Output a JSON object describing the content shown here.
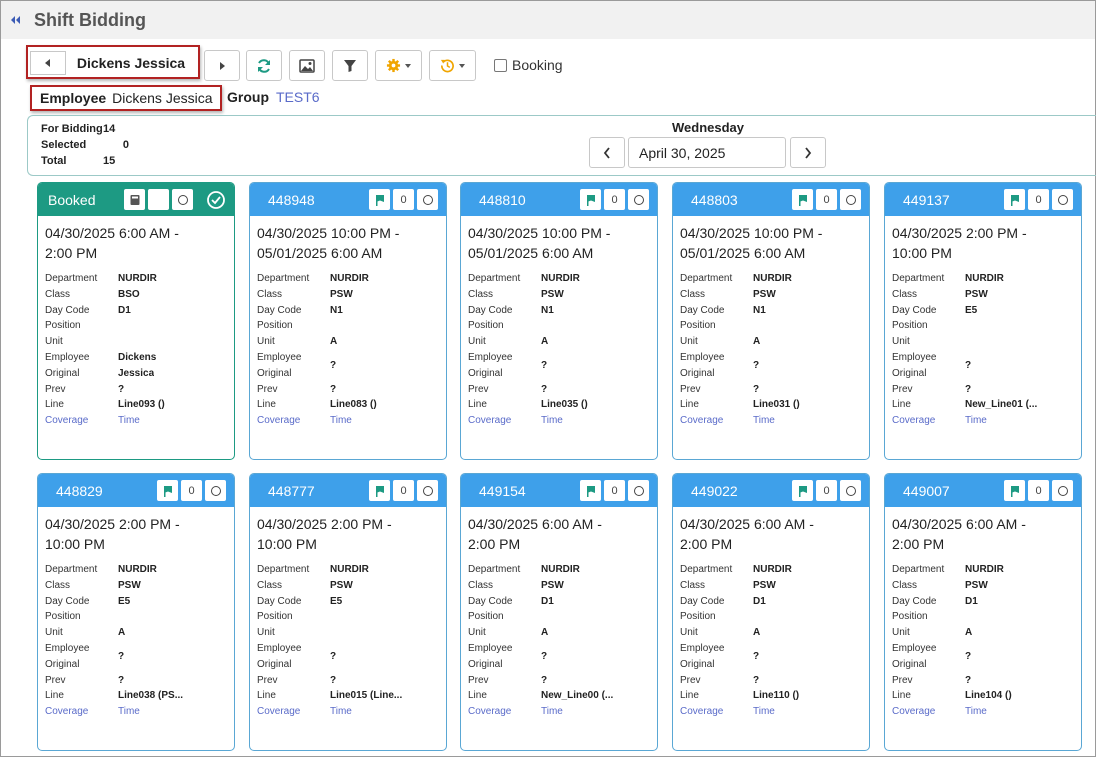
{
  "app": {
    "title": "Shift Bidding"
  },
  "toolbar": {
    "employee_nav_name": "Dickens Jessica",
    "booking_label": "Booking"
  },
  "employee": {
    "label": "Employee",
    "value": "Dickens Jessica"
  },
  "group": {
    "label": "Group",
    "value": "TEST6"
  },
  "summary": {
    "for_bidding_label": "For Bidding",
    "for_bidding": "14",
    "selected_label": "Selected",
    "selected": "0",
    "total_label": "Total",
    "total": "15"
  },
  "date": {
    "day": "Wednesday",
    "value": "April 30, 2025"
  },
  "field_labels": {
    "department": "Department",
    "class": "Class",
    "day_code": "Day Code",
    "position": "Position",
    "unit": "Unit",
    "employee": "Employee",
    "original": "Original",
    "prev": "Prev",
    "line": "Line",
    "coverage": "Coverage",
    "time": "Time"
  },
  "colors": {
    "card_header": "#3ea0ea",
    "booked_header": "#1d9a83",
    "link": "#5a6bc9",
    "highlight_border": "#b22222"
  },
  "cards": [
    {
      "id": "Booked",
      "booked": true,
      "count": "",
      "time1": "04/30/2025 6:00 AM -",
      "time2": "2:00 PM",
      "department": "NURDIR",
      "class": "BSO",
      "day_code": "D1",
      "position": "",
      "unit": "",
      "employee": "Dickens",
      "original": "Jessica",
      "prev": "?",
      "line": "Line093 ()"
    },
    {
      "id": "448948",
      "count": "0",
      "time1": "04/30/2025 10:00 PM -",
      "time2": "05/01/2025 6:00 AM",
      "department": "NURDIR",
      "class": "PSW",
      "day_code": "N1",
      "position": "",
      "unit": "A",
      "employee": "?",
      "original": "",
      "prev": "?",
      "line": "Line083 ()"
    },
    {
      "id": "448810",
      "count": "0",
      "time1": "04/30/2025 10:00 PM -",
      "time2": "05/01/2025 6:00 AM",
      "department": "NURDIR",
      "class": "PSW",
      "day_code": "N1",
      "position": "",
      "unit": "A",
      "employee": "?",
      "original": "",
      "prev": "?",
      "line": "Line035 ()"
    },
    {
      "id": "448803",
      "count": "0",
      "time1": "04/30/2025 10:00 PM -",
      "time2": "05/01/2025 6:00 AM",
      "department": "NURDIR",
      "class": "PSW",
      "day_code": "N1",
      "position": "",
      "unit": "A",
      "employee": "?",
      "original": "",
      "prev": "?",
      "line": "Line031 ()"
    },
    {
      "id": "449137",
      "count": "0",
      "time1": "04/30/2025 2:00 PM -",
      "time2": "10:00 PM",
      "department": "NURDIR",
      "class": "PSW",
      "day_code": "E5",
      "position": "",
      "unit": "",
      "employee": "?",
      "original": "",
      "prev": "?",
      "line": "New_Line01 (..."
    },
    {
      "id": "448829",
      "count": "0",
      "time1": "04/30/2025 2:00 PM -",
      "time2": "10:00 PM",
      "department": "NURDIR",
      "class": "PSW",
      "day_code": "E5",
      "position": "",
      "unit": "A",
      "employee": "?",
      "original": "",
      "prev": "?",
      "line": "Line038 (PS..."
    },
    {
      "id": "448777",
      "count": "0",
      "time1": "04/30/2025 2:00 PM -",
      "time2": "10:00 PM",
      "department": "NURDIR",
      "class": "PSW",
      "day_code": "E5",
      "position": "",
      "unit": "",
      "employee": "?",
      "original": "",
      "prev": "?",
      "line": "Line015 (Line..."
    },
    {
      "id": "449154",
      "count": "0",
      "time1": "04/30/2025 6:00 AM -",
      "time2": "2:00 PM",
      "department": "NURDIR",
      "class": "PSW",
      "day_code": "D1",
      "position": "",
      "unit": "A",
      "employee": "?",
      "original": "",
      "prev": "?",
      "line": "New_Line00 (..."
    },
    {
      "id": "449022",
      "count": "0",
      "time1": "04/30/2025 6:00 AM -",
      "time2": "2:00 PM",
      "department": "NURDIR",
      "class": "PSW",
      "day_code": "D1",
      "position": "",
      "unit": "A",
      "employee": "?",
      "original": "",
      "prev": "?",
      "line": "Line110 ()"
    },
    {
      "id": "449007",
      "count": "0",
      "time1": "04/30/2025 6:00 AM -",
      "time2": "2:00 PM",
      "department": "NURDIR",
      "class": "PSW",
      "day_code": "D1",
      "position": "",
      "unit": "A",
      "employee": "?",
      "original": "",
      "prev": "?",
      "line": "Line104 ()"
    }
  ]
}
